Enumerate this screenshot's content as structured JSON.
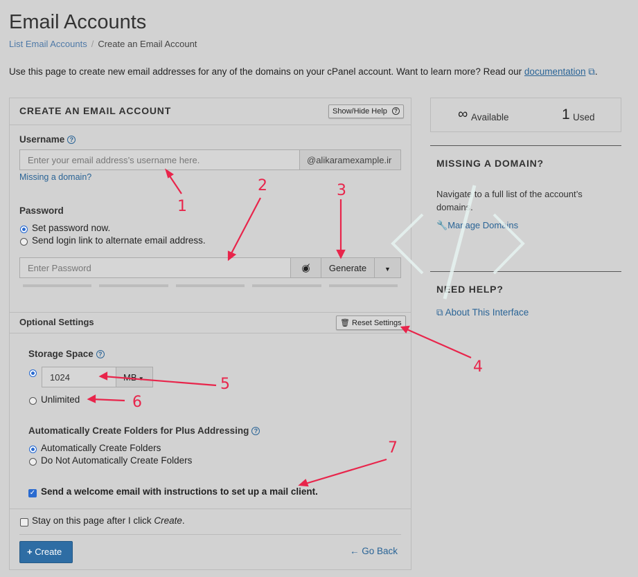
{
  "page": {
    "title": "Email Accounts",
    "breadcrumb": {
      "parent": "List Email Accounts",
      "current": "Create an Email Account"
    },
    "intro": "Use this page to create new email addresses for any of the domains on your cPanel account. Want to learn more? Read our",
    "intro_link": "documentation",
    "intro_end": "."
  },
  "panel": {
    "heading": "CREATE AN EMAIL ACCOUNT",
    "help_toggle": "Show/Hide Help",
    "username": {
      "label": "Username",
      "placeholder": "Enter your email address’s username here.",
      "domain": "@alikaramexample.ir",
      "missing_domain": "Missing a domain?"
    },
    "password": {
      "label": "Password",
      "option_set": "Set password now.",
      "option_link": "Send login link to alternate email address.",
      "placeholder": "Enter Password",
      "generate": "Generate"
    },
    "optional": {
      "heading": "Optional Settings",
      "reset": "Reset Settings",
      "storage_label": "Storage Space",
      "storage_value": "1024",
      "storage_unit": "MB",
      "unlimited": "Unlimited",
      "folders_label": "Automatically Create Folders for Plus Addressing",
      "folders_auto": "Automatically Create Folders",
      "folders_none": "Do Not Automatically Create Folders",
      "welcome": "Send a welcome email with instructions to set up a mail client."
    },
    "stay": {
      "text": "Stay on this page after I click ",
      "em": "Create",
      "end": "."
    },
    "create": "Create",
    "go_back": "Go Back"
  },
  "sidebar": {
    "available_symbol": "∞",
    "available_label": "Available",
    "used_count": "1",
    "used_label": "Used",
    "missing_heading": "MISSING A DOMAIN?",
    "missing_text": "Navigate to a full list of the account’s domains.",
    "manage_domains": "Manage Domains",
    "help_heading": "NEED HELP?",
    "about": "About This Interface"
  },
  "annotations": [
    "1",
    "2",
    "3",
    "4",
    "5",
    "6",
    "7"
  ],
  "colors": {
    "link": "#2a6496",
    "primary": "#2e6da4",
    "annotation": "#e8254b"
  }
}
